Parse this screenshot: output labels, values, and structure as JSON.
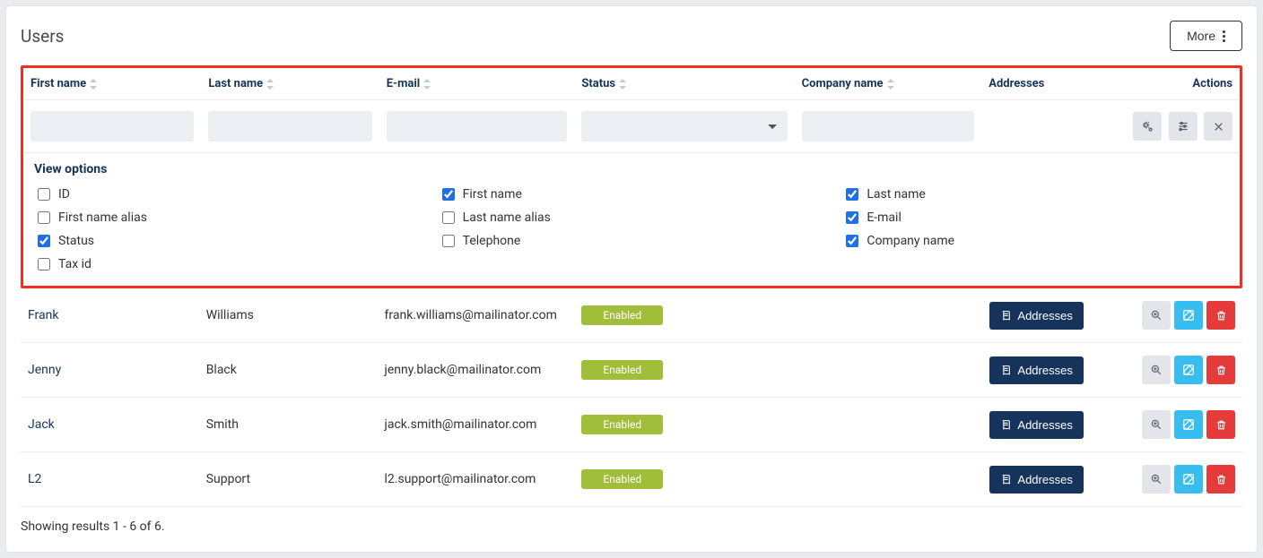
{
  "header": {
    "title": "Users",
    "more_label": "More"
  },
  "columns": {
    "first_name": "First name",
    "last_name": "Last name",
    "email": "E-mail",
    "status": "Status",
    "company_name": "Company name",
    "addresses": "Addresses",
    "actions": "Actions"
  },
  "filters": {
    "first_name": "",
    "last_name": "",
    "email": "",
    "status": "",
    "company_name": ""
  },
  "view_options": {
    "title": "View options",
    "items": [
      {
        "label": "ID",
        "checked": false
      },
      {
        "label": "First name",
        "checked": true
      },
      {
        "label": "Last name",
        "checked": true
      },
      {
        "label": "First name alias",
        "checked": false
      },
      {
        "label": "Last name alias",
        "checked": false
      },
      {
        "label": "E-mail",
        "checked": true
      },
      {
        "label": "Status",
        "checked": true
      },
      {
        "label": "Telephone",
        "checked": false
      },
      {
        "label": "Company name",
        "checked": true
      },
      {
        "label": "Tax id",
        "checked": false
      }
    ]
  },
  "rows": [
    {
      "first_name": "Frank",
      "last_name": "Williams",
      "email": "frank.williams@mailinator.com",
      "status": "Enabled",
      "company_name": "",
      "addresses_label": "Addresses"
    },
    {
      "first_name": "Jenny",
      "last_name": "Black",
      "email": "jenny.black@mailinator.com",
      "status": "Enabled",
      "company_name": "",
      "addresses_label": "Addresses"
    },
    {
      "first_name": "Jack",
      "last_name": "Smith",
      "email": "jack.smith@mailinator.com",
      "status": "Enabled",
      "company_name": "",
      "addresses_label": "Addresses"
    },
    {
      "first_name": "L2",
      "last_name": "Support",
      "email": "l2.support@mailinator.com",
      "status": "Enabled",
      "company_name": "",
      "addresses_label": "Addresses"
    }
  ],
  "footer": {
    "results_text": "Showing results 1 - 6 of 6."
  }
}
